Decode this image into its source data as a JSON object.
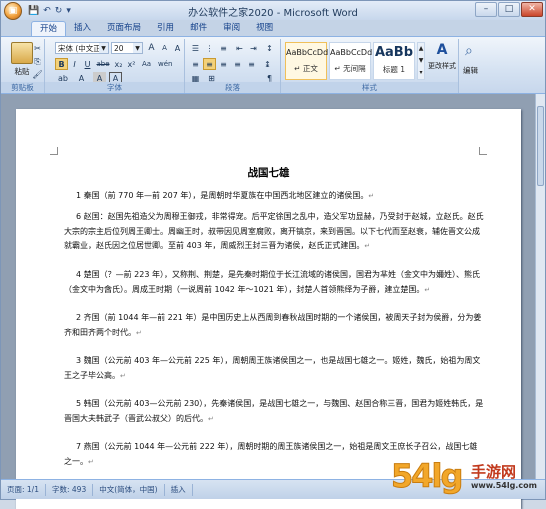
{
  "window": {
    "title": "办公软件之家2020 - Microsoft Word"
  },
  "qat": {
    "save": "💾",
    "undo": "↶",
    "redo": "↻",
    "more": "▾"
  },
  "tabs": [
    "开始",
    "插入",
    "页面布局",
    "引用",
    "邮件",
    "审阅",
    "视图"
  ],
  "active_tab": "开始",
  "ribbon": {
    "clipboard": {
      "paste_label": "粘贴",
      "group_label": "剪贴板"
    },
    "font": {
      "font_name": "宋体 (中文正)",
      "font_size": "20",
      "group_label": "字体",
      "bold": "B",
      "italic": "I",
      "underline": "U",
      "strike": "abe",
      "sub": "x₂",
      "sup": "x²",
      "grow": "A",
      "shrink": "A",
      "clear": "A",
      "phonetic": "wén",
      "border": "A",
      "highlight": "ab",
      "color": "A",
      "aa": "Aa",
      "char_shade": "A"
    },
    "paragraph": {
      "group_label": "段落"
    },
    "styles": {
      "group_label": "样式",
      "items": [
        {
          "sample": "AaBbCcDd",
          "name": "↵ 正文"
        },
        {
          "sample": "AaBbCcDd",
          "name": "↵ 无间隔"
        },
        {
          "sample": "AaBb",
          "name": "标题 1"
        }
      ],
      "change_styles": "更改样式"
    },
    "editing": {
      "label": "编辑"
    }
  },
  "document": {
    "title": "战国七雄",
    "paragraphs": [
      "1 秦国（前 770 年—前 207 年），是周朝时华夏族在中国西北地区建立的诸侯国。",
      "6 赵国：赵国先祖造父为周穆王御戎，非常得宠。后平定徐国之乱中，造父军功显赫，乃受封于赵城，立赵氏。赵氏大宗的宗主后位列周王卿士。周幽王时，叔带因见周室腐败，离开镐京，来到晋国。以下七代而至赵衰，辅佐晋文公成就霸业，赵氏因之位居世卿。至前 403 年，周威烈王封三晋为诸侯，赵氏正式建国。",
      "4 楚国（？—前 223 年），又称荆、荆楚，是先秦时期位于长江流域的诸侯国，国君为芈姓（金文中为嬭姓）、熊氏（金文中为酓氏）。周成王时期（一说周前 1042 年～1021 年），封楚人首领熊绎为子爵，建立楚国。",
      "2 齐国（前 1044 年—前 221 年）是中国历史上从西周到春秋战国时期的一个诸侯国，被周天子封为侯爵，分为姜齐和田齐两个时代。",
      "3 魏国（公元前 403 年—公元前 225 年），周朝周王族诸侯国之一，也是战国七雄之一。姬姓，魏氏，始祖为周文王之子毕公高。",
      "5 韩国（公元前 403—公元前 230），先秦诸侯国，是战国七雄之一，与魏国、赵国合称三晋，国君为姬姓韩氏，是晋国大夫韩武子（晋武公叔父）的后代。",
      "7 燕国（公元前 1044 年—公元前 222 年），周朝时期的周王族诸侯国之一，始祖是周文王庶长子召公，战国七雄之一。"
    ]
  },
  "status": {
    "page": "页面: 1/1",
    "words": "字数: 493",
    "lang": "中文(简体，中国)",
    "mode": "插入"
  },
  "watermark": {
    "digits": "54lg",
    "text": "手游网",
    "url": "www.54lg.com"
  }
}
